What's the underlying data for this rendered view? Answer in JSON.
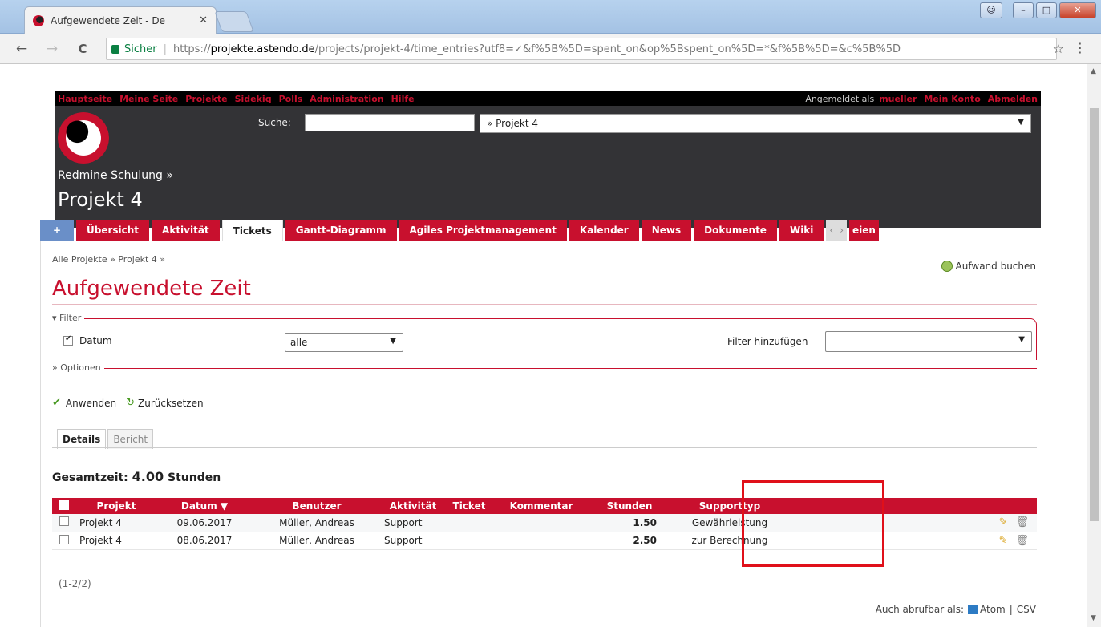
{
  "browser": {
    "tab_title": "Aufgewendete Zeit - De",
    "tab_close": "✕",
    "secure_label": "Sicher",
    "separator": "|",
    "url_prefix": "https://",
    "url_host": "projekte.astendo.de",
    "url_path": "/projects/projekt-4/time_entries?utf8=✓&f%5B%5D=spent_on&op%5Bspent_on%5D=*&f%5B%5D=&c%5B%5D",
    "star": "☆",
    "menu": "⋮",
    "back": "←",
    "forward": "→",
    "reload": "C"
  },
  "top_menu": {
    "items": [
      "Hauptseite",
      "Meine Seite",
      "Projekte",
      "Sidekiq",
      "Polls",
      "Administration",
      "Hilfe"
    ],
    "logged_in_label": "Angemeldet als",
    "user": "mueller",
    "my_account": "Mein Konto",
    "logout": "Abmelden"
  },
  "header": {
    "search_label": "Suche:",
    "search_value": "",
    "project_select": "» Projekt 4",
    "parent_crumb": "Redmine Schulung »",
    "project_title": "Projekt 4"
  },
  "tabs": {
    "plus": "+",
    "items": [
      "Übersicht",
      "Aktivität",
      "Tickets",
      "Gantt-Diagramm",
      "Agiles Projektmanagement",
      "Kalender",
      "News",
      "Dokumente",
      "Wiki"
    ],
    "active": "Tickets",
    "scroll_left": "‹",
    "scroll_right": "›",
    "more": "eien"
  },
  "content": {
    "breadcrumb": "Alle Projekte » Projekt 4 »",
    "log_time": "Aufwand buchen",
    "title": "Aufgewendete Zeit",
    "filter_legend": "▾ Filter",
    "filter_datum": "Datum",
    "filter_datum_value": "alle",
    "filter_add_label": "Filter hinzufügen",
    "filter_add_value": "",
    "options_legend": "» Optionen",
    "apply": "Anwenden",
    "reset": "Zurücksetzen",
    "subtab_details": "Details",
    "subtab_report": "Bericht",
    "total_label": "Gesamtzeit:",
    "total_value": "4.00",
    "total_unit": "Stunden",
    "pagination": "(1-2/2)",
    "export_label": "Auch abrufbar als:",
    "export_atom": "Atom",
    "export_sep": "|",
    "export_csv": "CSV"
  },
  "table": {
    "headers": [
      "Projekt",
      "Datum ▼",
      "Benutzer",
      "Aktivität",
      "Ticket",
      "Kommentar",
      "Stunden",
      "Supporttyp"
    ],
    "rows": [
      {
        "project": "Projekt 4",
        "date": "09.06.2017",
        "user": "Müller, Andreas",
        "activity": "Support",
        "ticket": "",
        "comment": "",
        "hours": "1.50",
        "supporttype": "Gewährleistung"
      },
      {
        "project": "Projekt 4",
        "date": "08.06.2017",
        "user": "Müller, Andreas",
        "activity": "Support",
        "ticket": "",
        "comment": "",
        "hours": "2.50",
        "supporttype": "zur Berechnung"
      }
    ]
  },
  "colors": {
    "brand_red": "#c8102e",
    "header_bg": "#333336",
    "highlight_red": "#e0101a"
  }
}
